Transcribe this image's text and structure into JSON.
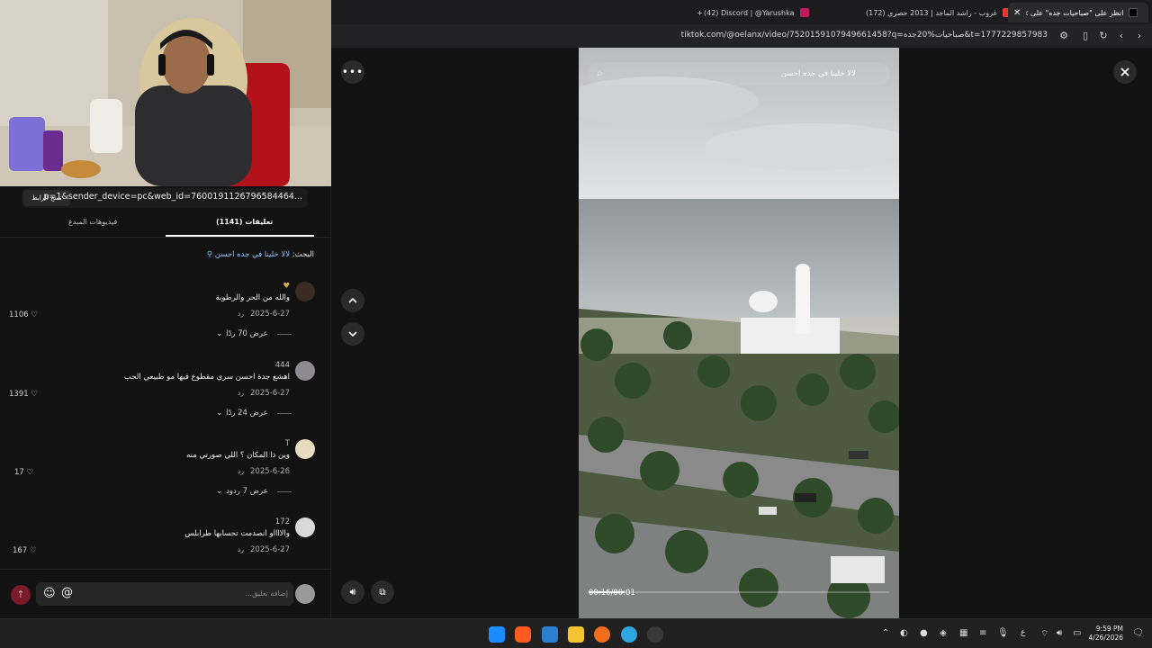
{
  "browser": {
    "tabs": [
      {
        "label": "انظر على \"صباحيات جده\" على TikTok",
        "active": true
      },
      {
        "label": "(172) غروب - راشد الماجد | 2013 حصري",
        "active": false
      },
      {
        "label": "(42) Discord | @Yarushka",
        "active": false
      }
    ],
    "new_tab": "+",
    "url": "tiktok.com/@oelanx/video/7520159107949661458?q=صباحيات%20جده&t=1777229857983"
  },
  "left_panel": {
    "share_url": "p=1&sender_device=pc&web_id=7600191126796584464...",
    "copy_link_label": "نسخ الرابط",
    "tabs": {
      "comments": "تعليقات (1141)",
      "creator_videos": "فيديوهات المبدع"
    },
    "search_prefix": "البحث:",
    "search_query": "لالا خلينا في جده احسن",
    "comments": [
      {
        "user": "",
        "text": "والله من الحر والرطوبة",
        "date": "2025-6-27",
        "reply": "رد",
        "likes": "1106",
        "more": "عرض 70 ردًا",
        "avatar_color": "#3a2c22",
        "badge": "♥"
      },
      {
        "user": "444",
        "text": "اهشع جدة احسن سري مقطوع فيها مو طبيعي الحب",
        "date": "2025-6-27",
        "reply": "رد",
        "likes": "1391",
        "more": "عرض 24 ردًا",
        "avatar_color": "#8e8a92"
      },
      {
        "user": "T",
        "text": "وين ذا المكان ؟ اللي صورتي منه",
        "date": "2025-6-26",
        "reply": "رد",
        "likes": "17",
        "more": "عرض 7 ردود",
        "avatar_color": "#e8dcc0"
      },
      {
        "user": "172",
        "text": "والااااو انصدمت تحسابها طرابلس",
        "date": "2025-6-27",
        "reply": "رد",
        "likes": "167",
        "more": "",
        "avatar_color": "#d9d9d9"
      }
    ],
    "comment_placeholder": "إضافة تعليق..."
  },
  "video": {
    "search_query": "لالا خلينا في جده احسن",
    "timecode": "00:16/00:01",
    "progress_fraction": 0.12
  },
  "taskbar": {
    "time": "9:59 PM",
    "date": "4/26/2026",
    "lang": "ع"
  },
  "colors": {
    "tiktok_accent": "#fe2c55",
    "link_blue": "#8fc3ff",
    "panel_bg": "#121212"
  }
}
